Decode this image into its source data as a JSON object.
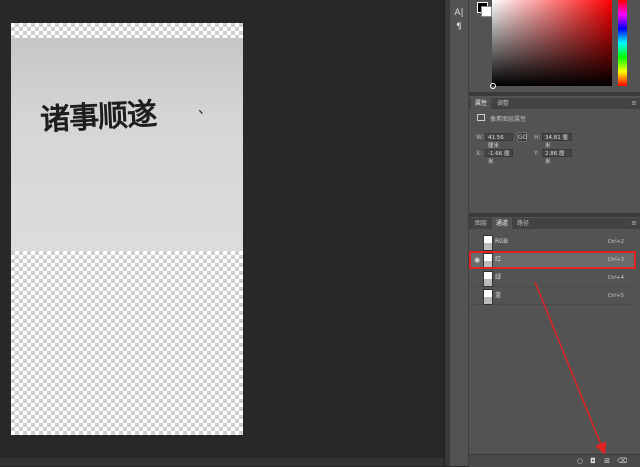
{
  "document": {
    "calligraphy_text": "诸事顺遂"
  },
  "tools": {
    "char_icon": "A|",
    "para_icon": "¶"
  },
  "properties": {
    "tabs": [
      {
        "label": "属性",
        "active": true
      },
      {
        "label": "调整",
        "active": false
      }
    ],
    "section_title": "像素图层属性",
    "w_label": "W:",
    "w_value": "41.56 厘米",
    "h_label": "H:",
    "h_value": "34.81 厘米",
    "x_label": "X:",
    "x_value": "-1.66 厘米",
    "y_label": "Y:",
    "y_value": "2.86 厘米",
    "link_symbol": "GO"
  },
  "channels_panel": {
    "tabs": [
      {
        "label": "图层",
        "active": false
      },
      {
        "label": "通道",
        "active": true
      },
      {
        "label": "路径",
        "active": false
      }
    ],
    "channels": [
      {
        "name": "RGB",
        "shortcut": "Ctrl+2",
        "visible": false,
        "selected": false
      },
      {
        "name": "红",
        "shortcut": "Ctrl+3",
        "visible": true,
        "selected": true
      },
      {
        "name": "绿",
        "shortcut": "Ctrl+4",
        "visible": false,
        "selected": false
      },
      {
        "name": "蓝",
        "shortcut": "Ctrl+5",
        "visible": false,
        "selected": false
      }
    ]
  },
  "colors": {
    "highlight": "#e02424",
    "arrow": "#e02424",
    "foreground": "#000000",
    "background": "#ffffff"
  }
}
